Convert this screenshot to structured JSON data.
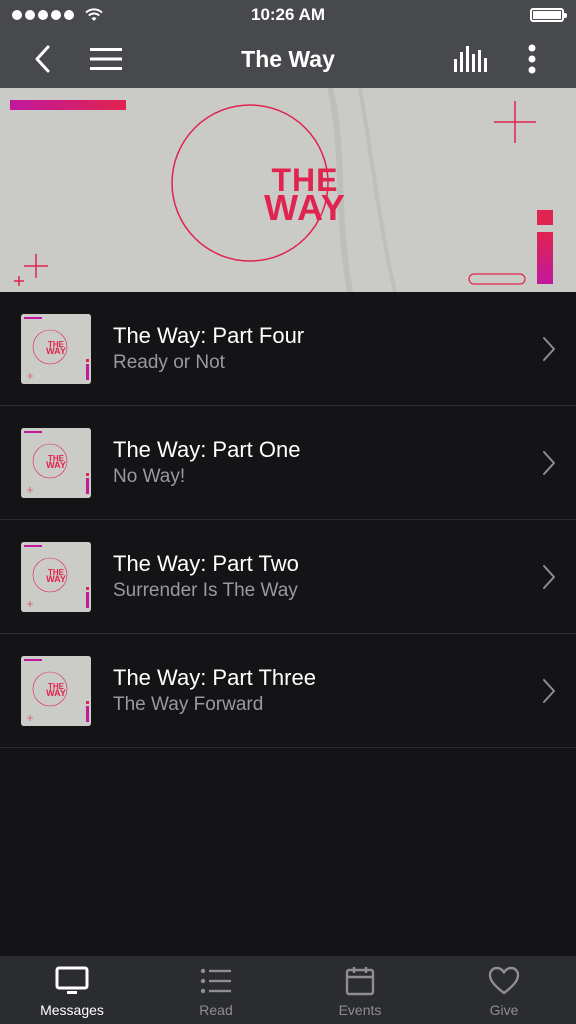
{
  "status_bar": {
    "time": "10:26 AM"
  },
  "nav": {
    "title": "The Way"
  },
  "banner": {
    "logo_line1": "THE",
    "logo_line2": "WAY"
  },
  "colors": {
    "accent": "#e0234f",
    "magenta": "#c2189e",
    "nav_bg": "#48494d",
    "list_bg": "#141416",
    "tab_bg": "#2b2c2f"
  },
  "messages": [
    {
      "title": "The Way: Part Four",
      "subtitle": "Ready or Not"
    },
    {
      "title": "The Way: Part One",
      "subtitle": "No Way!"
    },
    {
      "title": "The Way: Part Two",
      "subtitle": "Surrender Is The Way"
    },
    {
      "title": "The Way: Part Three",
      "subtitle": "The Way Forward"
    }
  ],
  "tabs": [
    {
      "label": "Messages",
      "icon": "tv-icon",
      "active": true
    },
    {
      "label": "Read",
      "icon": "list-icon",
      "active": false
    },
    {
      "label": "Events",
      "icon": "calendar-icon",
      "active": false
    },
    {
      "label": "Give",
      "icon": "heart-icon",
      "active": false
    }
  ]
}
